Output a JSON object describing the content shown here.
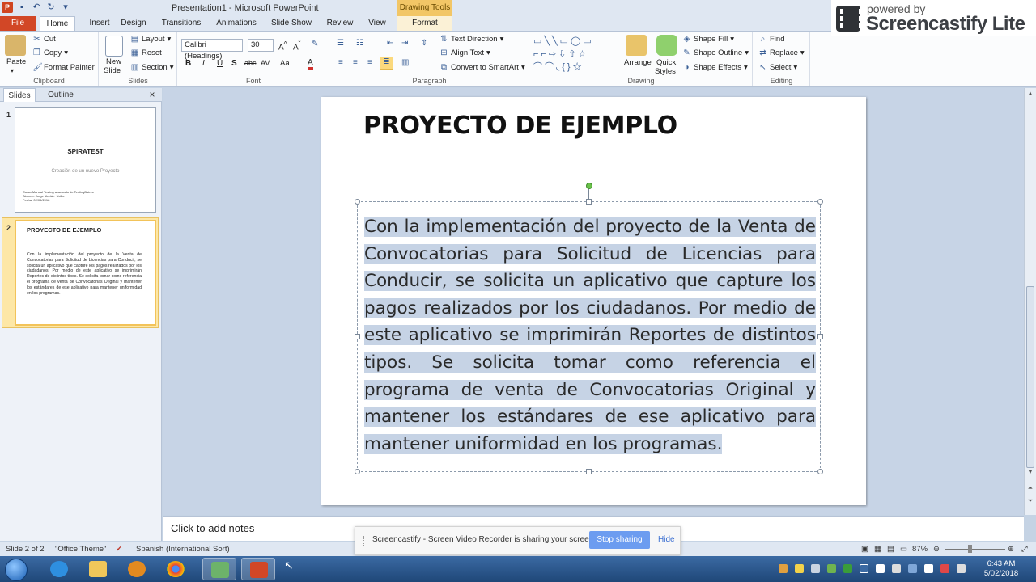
{
  "window": {
    "title": "Presentation1  -  Microsoft PowerPoint",
    "contextual_tab_group": "Drawing Tools"
  },
  "tabs": [
    "File",
    "Home",
    "Insert",
    "Design",
    "Transitions",
    "Animations",
    "Slide Show",
    "Review",
    "View",
    "Format"
  ],
  "ribbon": {
    "clipboard": {
      "paste": "Paste",
      "cut": "Cut",
      "copy": "Copy",
      "format_painter": "Format Painter",
      "label": "Clipboard"
    },
    "slides": {
      "new_slide": "New",
      "new_slide_2": "Slide",
      "layout": "Layout",
      "reset": "Reset",
      "section": "Section",
      "label": "Slides"
    },
    "font": {
      "font_name": "Calibri (Headings)",
      "font_size": "30",
      "label": "Font"
    },
    "paragraph": {
      "text_direction": "Text Direction",
      "align_text": "Align Text",
      "smartart": "Convert to SmartArt",
      "label": "Paragraph"
    },
    "drawing": {
      "arrange": "Arrange",
      "quick_styles": "Quick",
      "quick_styles_2": "Styles",
      "shape_fill": "Shape Fill",
      "shape_outline": "Shape Outline",
      "shape_effects": "Shape Effects",
      "label": "Drawing"
    },
    "editing": {
      "find": "Find",
      "replace": "Replace",
      "select": "Select",
      "label": "Editing"
    }
  },
  "screencastify_badge": {
    "powered": "powered by",
    "name": "Screencastify Lite"
  },
  "panel": {
    "tab_slides": "Slides",
    "tab_outline": "Outline",
    "close": "×",
    "slide1": {
      "num": "1",
      "title": "SPIRATEST",
      "subtitle": "Creación de un nuevo Proyecto",
      "meta": "Curso Manual Testing avanzado de TestingBaires\nAlumno: Jorge  Adrián  Ucllor\nFecha: 02/05/2018"
    },
    "slide2": {
      "num": "2",
      "title": "PROYECTO DE EJEMPLO",
      "body": "Con la implementación del proyecto de la Venta de Convocatorias para Solicitud de Licencias para Conducir, se solicita un aplicativo que capture los pagos realizados por los ciudadanos. Por medio de este aplicativo se imprimirán Reportes de distintos tipos. Se solicita tomar como referencia el programa de venta de Convocatorias Original y mantener los estándares de ese aplicativo para mantener uniformidad en los programas."
    }
  },
  "slide": {
    "title": "PROYECTO DE EJEMPLO",
    "body": "Con la implementación del proyecto de la Venta de Convocatorias para Solicitud de Licencias para Conducir, se solicita un aplicativo que capture los pagos realizados por los ciudadanos. Por medio de este aplicativo se imprimirán Reportes de distintos tipos. Se solicita tomar como referencia el programa de venta de Convocatorias Original y mantener los estándares de ese aplicativo para mantener uniformidad en los programas. "
  },
  "notes": {
    "placeholder": "Click to add notes"
  },
  "status": {
    "slide_counter": "Slide 2 of 2",
    "theme": "\"Office Theme\"",
    "language": "Spanish (International Sort)",
    "zoom": "87%"
  },
  "sharebar": {
    "message": "Screencastify - Screen Video Recorder is sharing your screen.",
    "stop": "Stop sharing",
    "hide": "Hide"
  },
  "clock": {
    "time": "6:43 AM",
    "date": "5/02/2018"
  },
  "colors": {
    "file_tab": "#d24726",
    "selection": "#c6d3e5",
    "stop_button": "#6c9cf0"
  }
}
